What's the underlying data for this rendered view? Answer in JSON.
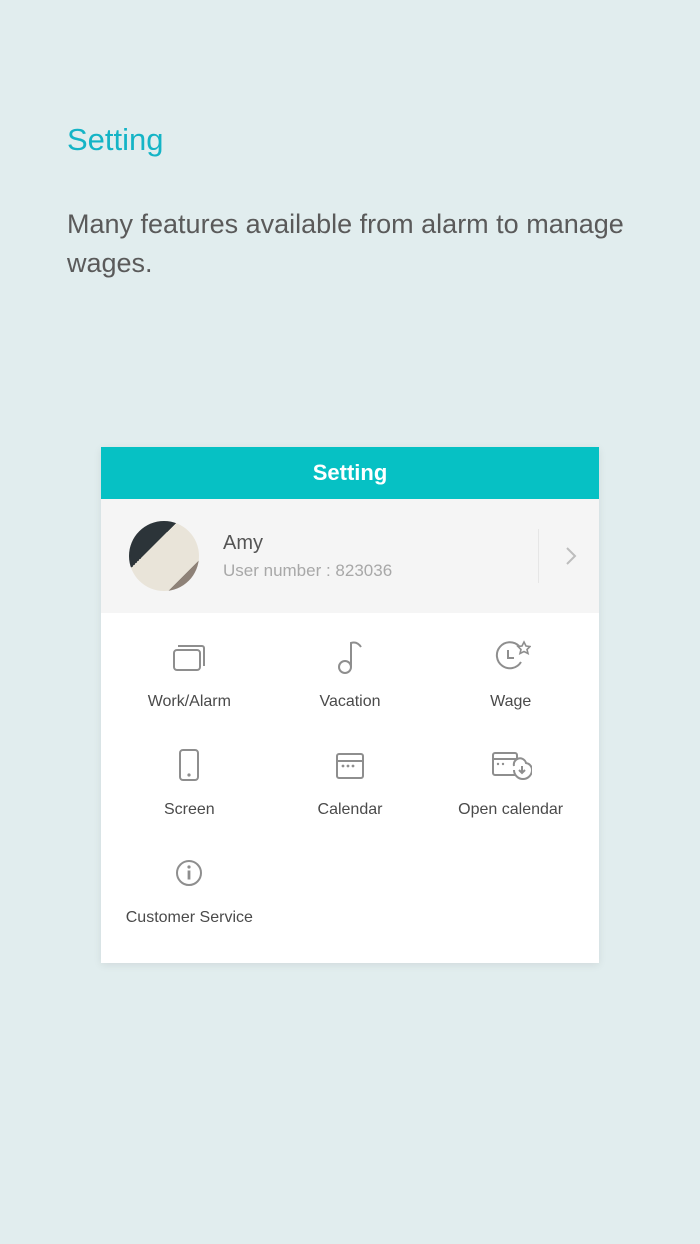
{
  "page": {
    "title": "Setting",
    "description": "Many features available from alarm to manage wages."
  },
  "card": {
    "header": "Setting",
    "profile": {
      "name": "Amy",
      "user_number_label": "User number : 823036"
    },
    "items": [
      {
        "label": "Work/Alarm"
      },
      {
        "label": "Vacation"
      },
      {
        "label": "Wage"
      },
      {
        "label": "Screen"
      },
      {
        "label": "Calendar"
      },
      {
        "label": "Open calendar"
      },
      {
        "label": "Customer Service"
      }
    ]
  }
}
